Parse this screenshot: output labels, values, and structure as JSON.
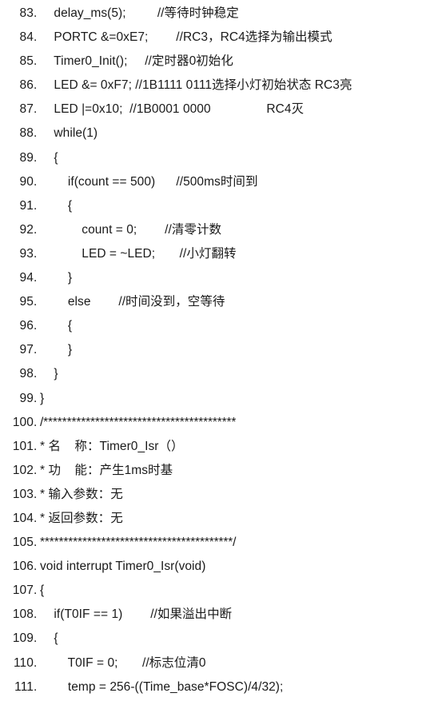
{
  "document": {
    "kind": "source-code-listing",
    "language": "C",
    "background_color": "#ffffff",
    "text_color": "#1a1a1a",
    "first_line_number": 83,
    "last_line_number": 111,
    "line_number_suffix": "."
  },
  "lines": [
    {
      "number": "83",
      "code": "    delay_ms(5);         //等待时钟稳定"
    },
    {
      "number": "84",
      "code": "    PORTC &=0xE7;        //RC3，RC4选择为输出模式"
    },
    {
      "number": "85",
      "code": "    Timer0_Init();     //定时器0初始化"
    },
    {
      "number": "86",
      "code": "    LED &= 0xF7; //1B1111 0111选择小灯初始状态 RC3亮"
    },
    {
      "number": "87",
      "code": "    LED |=0x10;  //1B0001 0000                RC4灭"
    },
    {
      "number": "88",
      "code": "    while(1)"
    },
    {
      "number": "89",
      "code": "    {"
    },
    {
      "number": "90",
      "code": "        if(count == 500)      //500ms时间到"
    },
    {
      "number": "91",
      "code": "        {"
    },
    {
      "number": "92",
      "code": "            count = 0;        //清零计数"
    },
    {
      "number": "93",
      "code": "            LED = ~LED;       //小灯翻转"
    },
    {
      "number": "94",
      "code": "        }"
    },
    {
      "number": "95",
      "code": "        else        //时间没到，空等待"
    },
    {
      "number": "96",
      "code": "        {"
    },
    {
      "number": "97",
      "code": "        }"
    },
    {
      "number": "98",
      "code": "    }"
    },
    {
      "number": "99",
      "code": "}"
    },
    {
      "number": "100",
      "code": "/*****************************************"
    },
    {
      "number": "101",
      "code": "* 名    称：Timer0_Isr（）"
    },
    {
      "number": "102",
      "code": "* 功    能：产生1ms时基"
    },
    {
      "number": "103",
      "code": "* 输入参数：无"
    },
    {
      "number": "104",
      "code": "* 返回参数：无"
    },
    {
      "number": "105",
      "code": "*****************************************/"
    },
    {
      "number": "106",
      "code": "void interrupt Timer0_Isr(void)"
    },
    {
      "number": "107",
      "code": "{"
    },
    {
      "number": "108",
      "code": "    if(T0IF == 1)        //如果溢出中断"
    },
    {
      "number": "109",
      "code": "    {"
    },
    {
      "number": "110",
      "code": "        T0IF = 0;       //标志位清0"
    },
    {
      "number": "111",
      "code": "        temp = 256-((Time_base*FOSC)/4/32);"
    }
  ]
}
